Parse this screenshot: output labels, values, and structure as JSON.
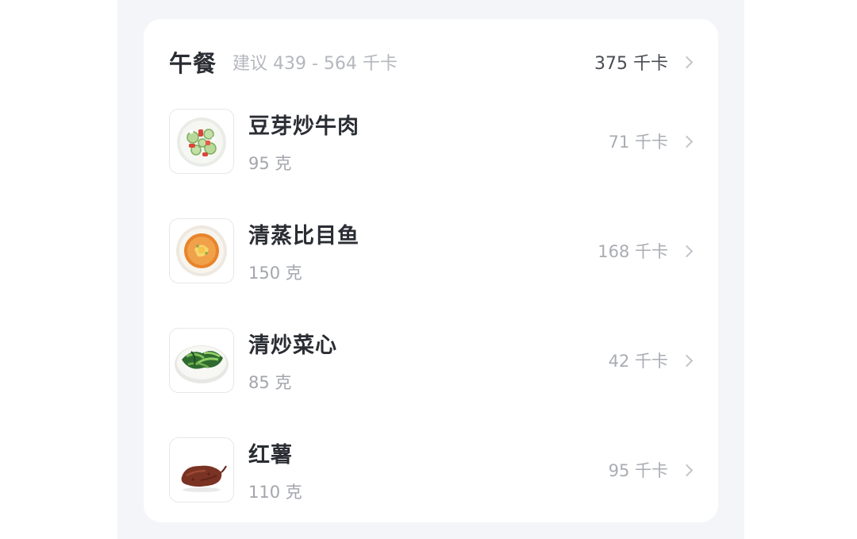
{
  "meal": {
    "title": "午餐",
    "suggestion": "建议 439 - 564 千卡",
    "total": "375 千卡",
    "items": [
      {
        "name": "豆芽炒牛肉",
        "weight": "95 克",
        "kcal": "71 千卡",
        "icon": "salad-plate-icon"
      },
      {
        "name": "清蒸比目鱼",
        "weight": "150 克",
        "kcal": "168 千卡",
        "icon": "soup-plate-icon"
      },
      {
        "name": "清炒菜心",
        "weight": "85 克",
        "kcal": "42 千卡",
        "icon": "greens-plate-icon"
      },
      {
        "name": "红薯",
        "weight": "110 克",
        "kcal": "95 千卡",
        "icon": "sweet-potato-icon"
      }
    ]
  },
  "colors": {
    "background": "#f4f5f8",
    "card": "#ffffff",
    "title_text": "#2a2d33",
    "secondary_text": "#a3a6ad"
  }
}
